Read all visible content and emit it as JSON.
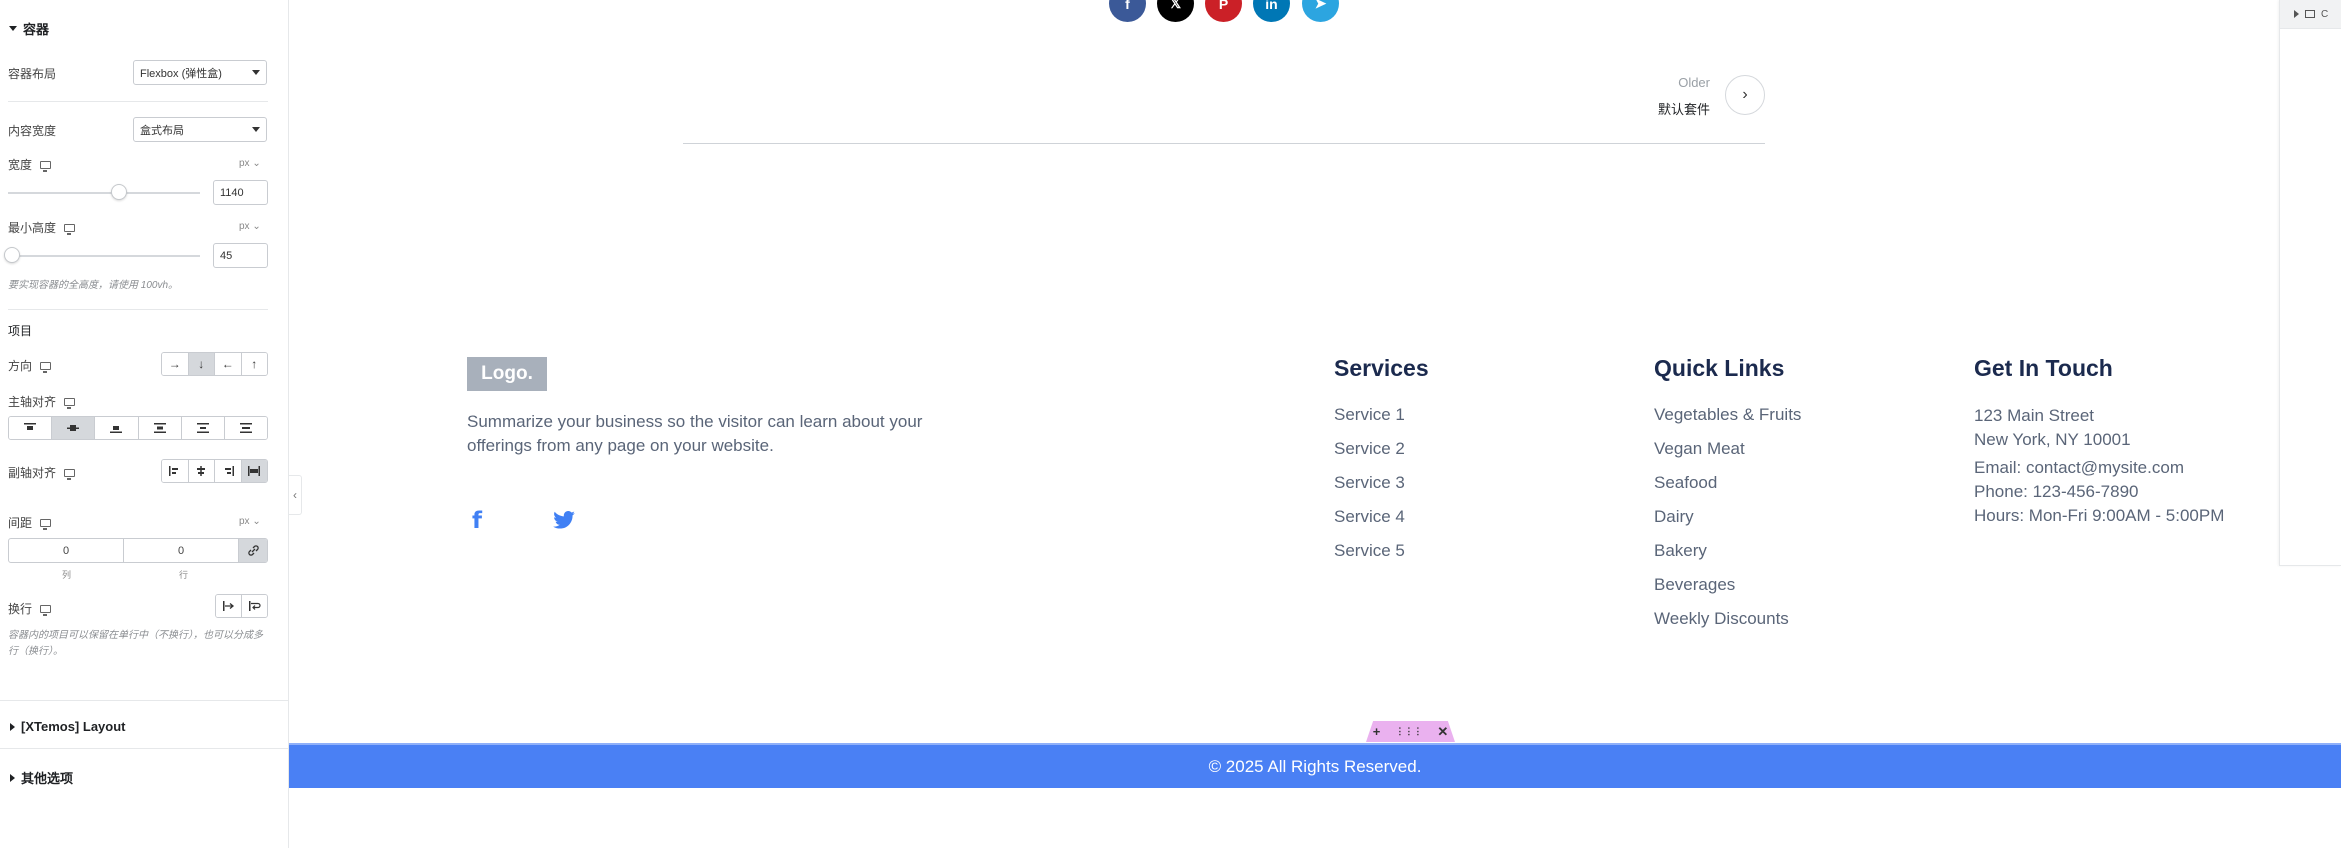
{
  "panel": {
    "container_section": "容器",
    "layout_label": "容器布局",
    "layout_value": "Flexbox (弹性盒)",
    "content_width_label": "内容宽度",
    "content_width_value": "盒式布局",
    "width_label": "宽度",
    "width_unit": "px",
    "width_value": "1140",
    "min_height_label": "最小高度",
    "min_height_unit": "px",
    "min_height_value": "45",
    "min_height_hint": "要实现容器的全高度，请使用 100vh。",
    "items_heading": "项目",
    "direction_label": "方向",
    "direction_buttons": [
      "→",
      "↓",
      "←",
      "↑"
    ],
    "justify_label": "主轴对齐",
    "align_label": "副轴对齐",
    "gap_label": "间距",
    "gap_unit": "px",
    "gap_column_value": "0",
    "gap_row_value": "0",
    "gap_column_caption": "列",
    "gap_row_caption": "行",
    "wrap_label": "换行",
    "wrap_hint": "容器内的项目可以保留在单行中（不换行），也可以分成多行（换行）。",
    "xtemos_section": "[XTemos] Layout",
    "other_section": "其他选项"
  },
  "social_icons": [
    "facebook-icon",
    "x-icon",
    "pinterest-icon",
    "linkedin-icon",
    "telegram-icon"
  ],
  "social_letters": [
    "f",
    "𝕏",
    "P",
    "in",
    "➤"
  ],
  "colors": {
    "facebook": "#3b5998",
    "x": "#000000",
    "pinterest": "#cb2027",
    "linkedin": "#0077b5",
    "telegram": "#2ca5e0",
    "accent_blue": "#4a80f4",
    "handle_pink": "#eab1ef"
  },
  "post_nav": {
    "older_label": "Older",
    "older_title": "默认套件",
    "arrow": "›"
  },
  "footer": {
    "logo": "Logo.",
    "summary": "Summarize your business so the visitor can learn about your offerings from any page on your website.",
    "services": {
      "title": "Services",
      "items": [
        "Service 1",
        "Service 2",
        "Service 3",
        "Service 4",
        "Service 5"
      ]
    },
    "quick_links": {
      "title": "Quick Links",
      "items": [
        "Vegetables & Fruits",
        "Vegan Meat",
        "Seafood",
        "Dairy",
        "Bakery",
        "Beverages",
        "Weekly Discounts"
      ]
    },
    "contact": {
      "title": "Get In Touch",
      "address_line1": "123 Main Street",
      "address_line2": "New York, NY 10001",
      "email": "Email: contact@mysite.com",
      "phone": "Phone: 123-456-7890",
      "hours": "Hours: Mon-Fri 9:00AM - 5:00PM"
    },
    "copyright": "© 2025 All Rights Reserved."
  },
  "handle": {
    "add": "+",
    "drag": "⋮⋮⋮",
    "close": "✕"
  },
  "right_panel": {
    "label": "C"
  }
}
